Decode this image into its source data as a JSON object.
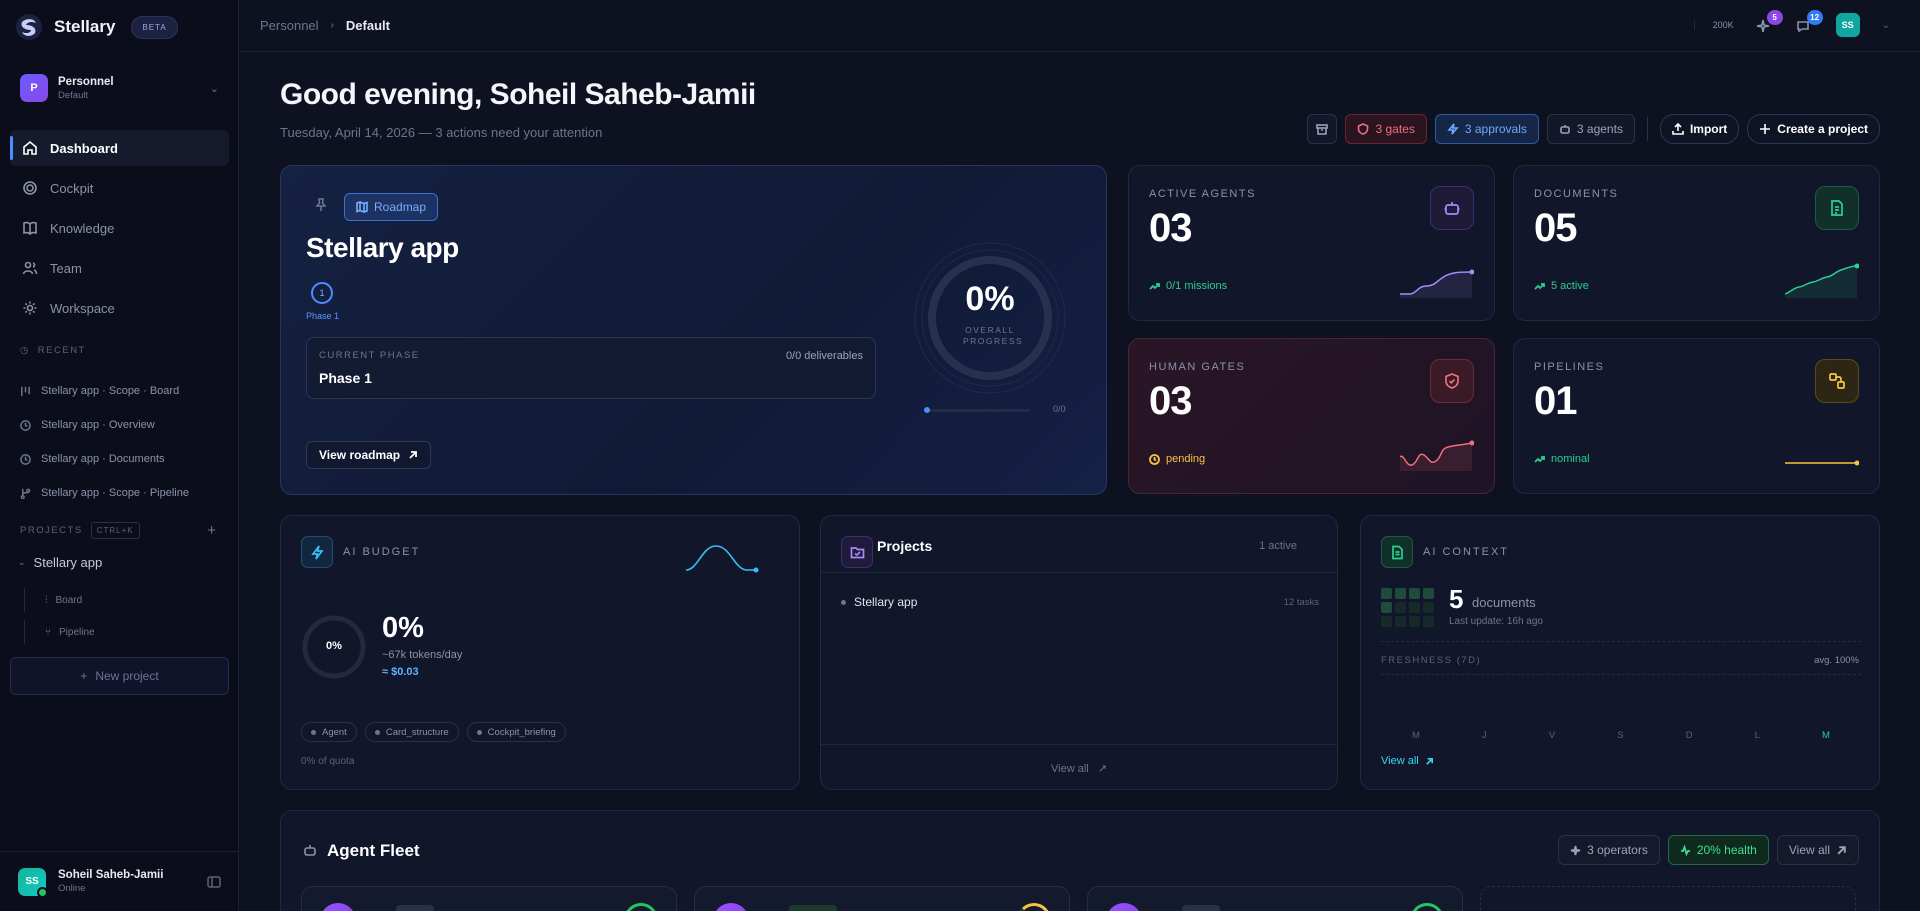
{
  "brand": {
    "name": "Stellary",
    "badge": "BETA"
  },
  "workspace": {
    "initial": "P",
    "name": "Personnel",
    "sub": "Default"
  },
  "nav": [
    {
      "label": "Dashboard",
      "icon": "home-icon",
      "active": true
    },
    {
      "label": "Cockpit",
      "icon": "target-icon"
    },
    {
      "label": "Knowledge",
      "icon": "book-icon"
    },
    {
      "label": "Team",
      "icon": "users-icon"
    },
    {
      "label": "Workspace",
      "icon": "gear-icon"
    }
  ],
  "recent": {
    "label": "RECENT",
    "items": [
      {
        "label": "Stellary app · Scope · Board",
        "icon": "board-icon"
      },
      {
        "label": "Stellary app · Overview",
        "icon": "clock-icon"
      },
      {
        "label": "Stellary app · Documents",
        "icon": "clock-icon"
      },
      {
        "label": "Stellary app · Scope · Pipeline",
        "icon": "branch-icon"
      }
    ]
  },
  "projects_nav": {
    "label": "PROJECTS",
    "shortcut": "CTRL+K",
    "project": "Stellary app",
    "subs": [
      "Board",
      "Pipeline"
    ],
    "new_label": "New project"
  },
  "user": {
    "initials": "SS",
    "name": "Soheil Saheb-Jamii",
    "status": "Online"
  },
  "topbar": {
    "crumb_parent": "Personnel",
    "crumb_current": "Default",
    "tokens": "200K",
    "agents_badge": "5",
    "messages_badge": "12",
    "avatar": "SS"
  },
  "greeting": {
    "title": "Good evening, Soheil Saheb-Jamii",
    "subtitle": "Tuesday, April 14, 2026 — 3 actions need your attention"
  },
  "actions": {
    "gates": "3 gates",
    "approvals": "3 approvals",
    "agents": "3 agents",
    "import": "Import",
    "create": "Create a project"
  },
  "roadmap": {
    "tag": "Roadmap",
    "title": "Stellary app",
    "phase_num": "1",
    "phase_label": "Phase 1",
    "current_phase_label": "CURRENT PHASE",
    "current_phase": "Phase 1",
    "deliverables": "0/0 deliverables",
    "progress_pct": "0%",
    "progress_label": "OVERALL PROGRESS",
    "progress_ratio": "0/0",
    "progress_value": 0,
    "view_label": "View roadmap"
  },
  "stats": {
    "agents": {
      "label": "ACTIVE AGENTS",
      "value": "03",
      "foot": "0/1 missions",
      "color": "#a78bfa"
    },
    "documents": {
      "label": "DOCUMENTS",
      "value": "05",
      "foot": "5 active",
      "color": "#2ccf8f"
    },
    "gates": {
      "label": "HUMAN GATES",
      "value": "03",
      "foot": "pending",
      "color": "#f06e7c"
    },
    "pipelines": {
      "label": "PIPELINES",
      "value": "01",
      "foot": "nominal",
      "color": "#f5c542"
    }
  },
  "budget": {
    "label": "AI BUDGET",
    "ring_pct": "0%",
    "pct": "0%",
    "tokens": "~67k tokens/day",
    "cost": "≈ $0.03",
    "chips": [
      "Agent",
      "Card_structure",
      "Cockpit_briefing"
    ],
    "quota": "0% of quota"
  },
  "projects_card": {
    "title": "Projects",
    "count": "1 active",
    "rows": [
      {
        "name": "Stellary app",
        "tasks": "12 tasks"
      }
    ],
    "view_all": "View all"
  },
  "context": {
    "label": "AI CONTEXT",
    "count": "5",
    "count_label": "documents",
    "updated": "Last update: 16h ago",
    "freshness_label": "FRESHNESS (7D)",
    "avg": "avg. 100%",
    "days": [
      "M",
      "J",
      "V",
      "S",
      "D",
      "L",
      "M"
    ],
    "view_all": "View all"
  },
  "fleet": {
    "title": "Agent Fleet",
    "operators": "3 operators",
    "health": "20% health",
    "view_all": "View all"
  }
}
